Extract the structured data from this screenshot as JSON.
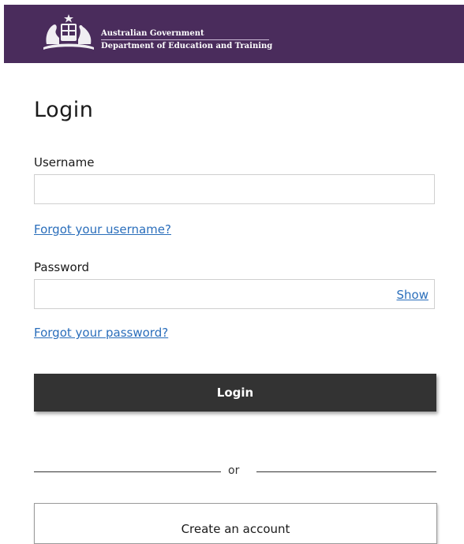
{
  "header": {
    "line1": "Australian Government",
    "line2": "Department of Education and Training",
    "background": "#4a2c5c"
  },
  "page_title": "Login",
  "username": {
    "label": "Username",
    "value": "",
    "placeholder": ""
  },
  "forgot_username": "Forgot your username?",
  "password": {
    "label": "Password",
    "value": "",
    "placeholder": "",
    "show_label": "Show"
  },
  "forgot_password": "Forgot your password?",
  "login_button": "Login",
  "divider_text": "or",
  "create_account_button": "Create an account",
  "colors": {
    "link": "#2a6ebb",
    "primary_button": "#333333"
  },
  "icons": {
    "crest": "coat-of-arms-icon"
  }
}
